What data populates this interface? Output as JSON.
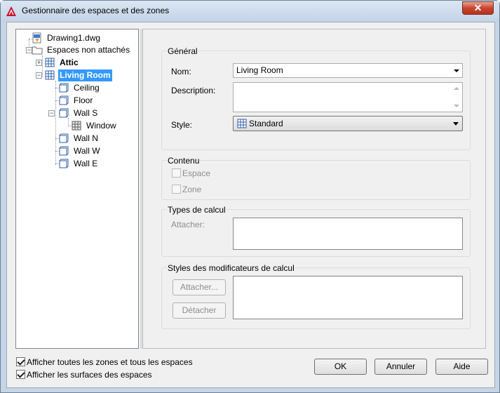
{
  "window": {
    "title": "Gestionnaire des espaces et des zones",
    "close_glyph": "✕"
  },
  "tree": {
    "items": [
      {
        "label": "Drawing1.dwg",
        "icon": "drawing-file-icon"
      },
      {
        "label": "Espaces non attachés",
        "icon": "folder-icon"
      },
      {
        "label": "Attic",
        "icon": "zone-icon"
      },
      {
        "label": "Living Room",
        "icon": "zone-icon",
        "selected": true
      },
      {
        "label": "Ceiling",
        "icon": "space-icon"
      },
      {
        "label": "Floor",
        "icon": "space-icon"
      },
      {
        "label": "Wall S",
        "icon": "space-icon"
      },
      {
        "label": "Window",
        "icon": "window-icon"
      },
      {
        "label": "Wall N",
        "icon": "space-icon"
      },
      {
        "label": "Wall W",
        "icon": "space-icon"
      },
      {
        "label": "Wall E",
        "icon": "space-icon"
      }
    ]
  },
  "general": {
    "title": "Général",
    "name_label": "Nom:",
    "name_value": "Living Room",
    "description_label": "Description:",
    "style_label": "Style:",
    "style_value": "Standard"
  },
  "contenu": {
    "title": "Contenu",
    "espace_label": "Espace",
    "zone_label": "Zone"
  },
  "calc_types": {
    "title": "Types de calcul",
    "attach_label": "Attacher:"
  },
  "calc_mods": {
    "title": "Styles des modificateurs de calcul",
    "attach_button": "Attacher...",
    "detach_button": "Détacher"
  },
  "options": {
    "show_all_label": "Afficher toutes les zones et tous les espaces",
    "show_surfaces_label": "Afficher les surfaces des espaces"
  },
  "buttons": {
    "ok": "OK",
    "cancel": "Annuler",
    "help": "Aide"
  }
}
